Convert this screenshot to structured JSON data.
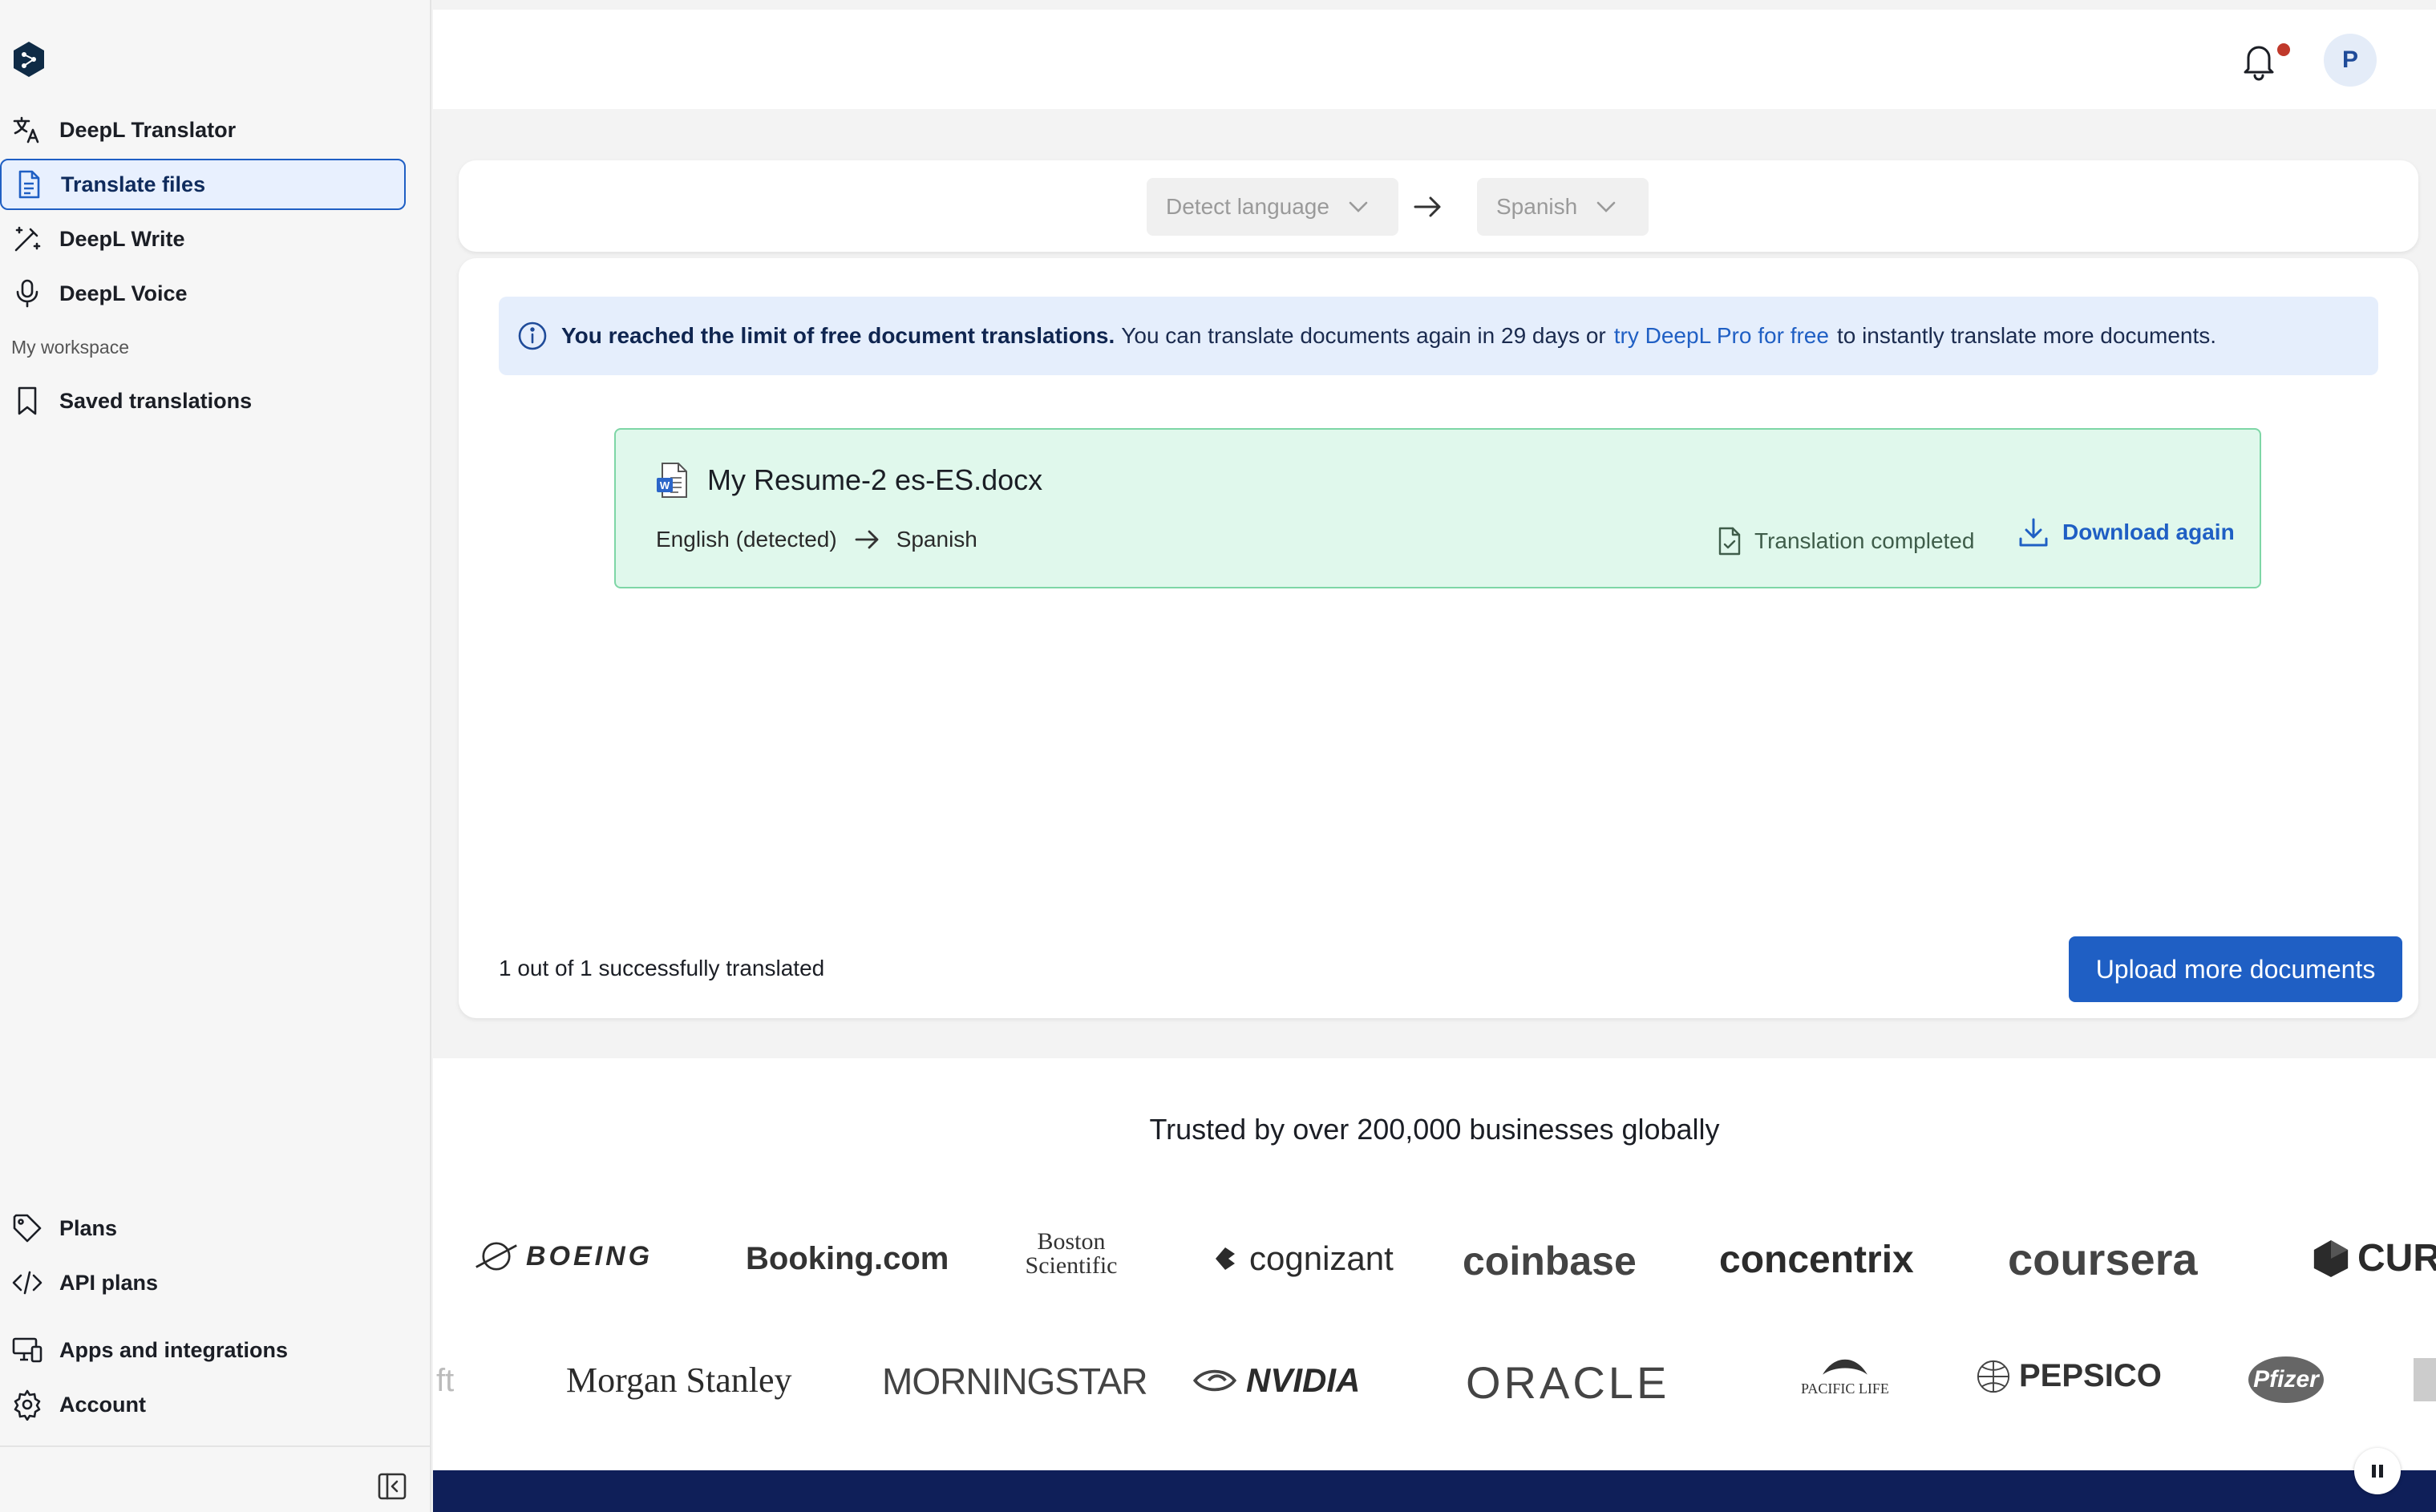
{
  "sidebar": {
    "items": [
      {
        "label": "DeepL Translator",
        "icon": "translate-icon"
      },
      {
        "label": "Translate files",
        "icon": "document-icon",
        "active": true
      },
      {
        "label": "DeepL Write",
        "icon": "magic-wand-icon"
      },
      {
        "label": "DeepL Voice",
        "icon": "microphone-icon"
      }
    ],
    "section_label": "My workspace",
    "workspace_items": [
      {
        "label": "Saved translations",
        "icon": "bookmark-icon"
      }
    ],
    "bottom_items": [
      {
        "label": "Plans",
        "icon": "tag-icon"
      },
      {
        "label": "API plans",
        "icon": "code-icon"
      },
      {
        "label": "Apps and integrations",
        "icon": "apps-icon"
      },
      {
        "label": "Account",
        "icon": "gear-icon"
      }
    ]
  },
  "header": {
    "avatar_initial": "P",
    "has_notification": true
  },
  "language_bar": {
    "source": "Detect language",
    "target": "Spanish"
  },
  "banner": {
    "bold": "You reached the limit of free document translations.",
    "text_before_link": "You can translate documents again in 29 days or",
    "link": "try DeepL Pro for free",
    "text_after_link": "to instantly translate more documents."
  },
  "file": {
    "name": "My Resume-2 es-ES.docx",
    "source_lang": "English (detected)",
    "target_lang": "Spanish",
    "status": "Translation completed",
    "download_label": "Download again"
  },
  "summary": "1 out of 1 successfully translated",
  "upload_label": "Upload more documents",
  "trusted": {
    "title": "Trusted by over 200,000 businesses globally",
    "row1": [
      "BOEING",
      "Booking.com",
      "Boston Scientific",
      "cognizant",
      "coinbase",
      "concentrix",
      "coursera",
      "CURS"
    ],
    "row2": [
      "ft",
      "Morgan Stanley",
      "MORNINGSTAR",
      "NVIDIA",
      "ORACLE",
      "PACIFIC LIFE",
      "PEPSICO",
      "Pfizer"
    ]
  },
  "colors": {
    "accent": "#1f5fc4",
    "banner_bg": "#e5eefc",
    "success_bg": "#e0f8ec",
    "success_border": "#7ed6a6",
    "footer": "#0f1f59"
  }
}
